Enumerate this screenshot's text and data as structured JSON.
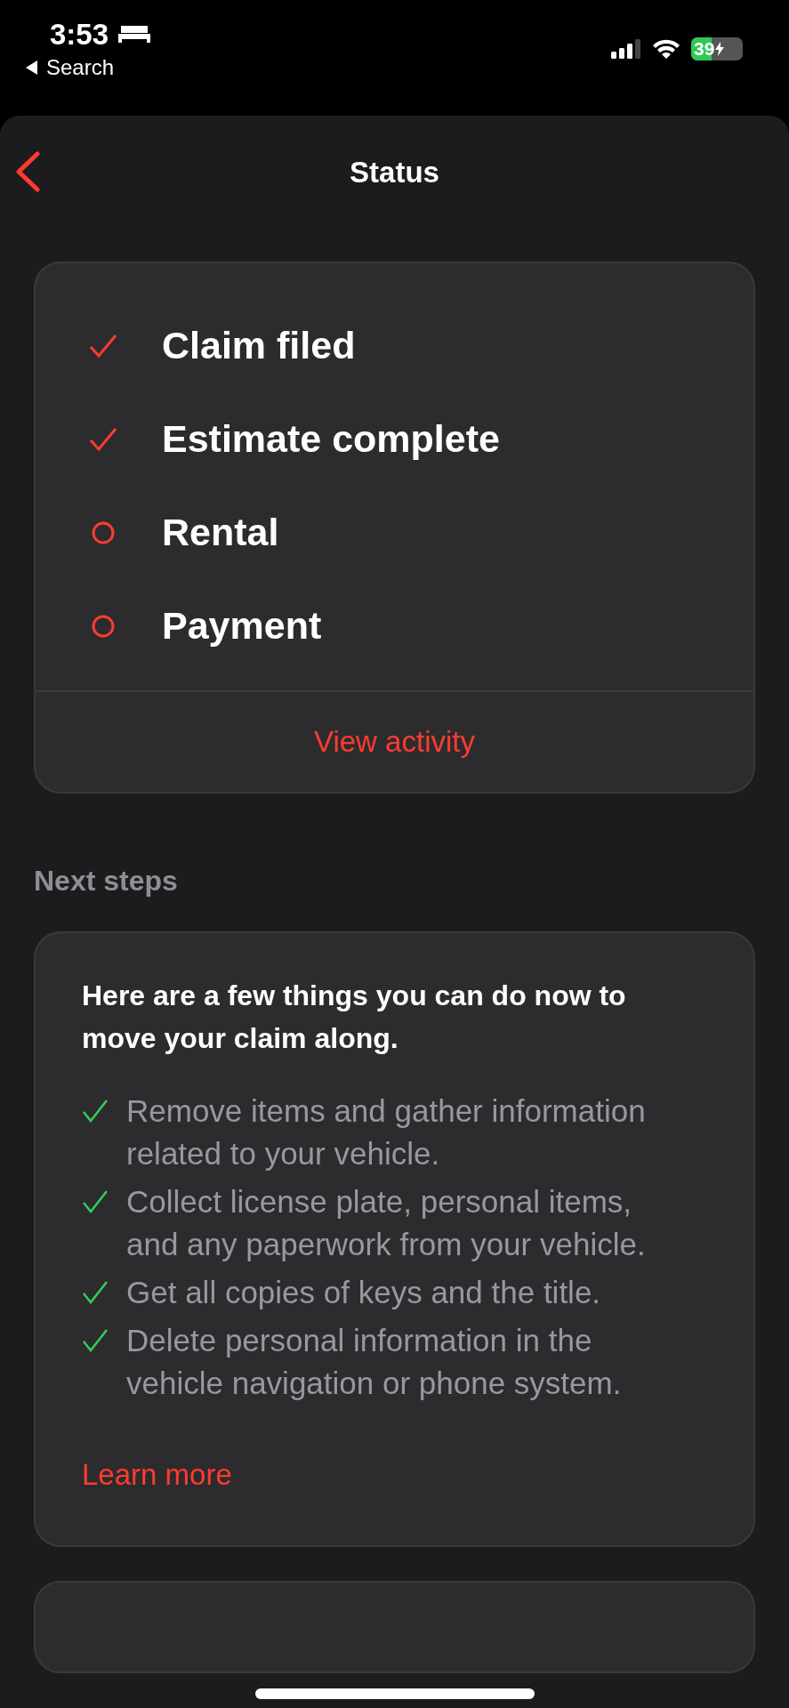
{
  "status_bar": {
    "time": "3:53",
    "back_label": "Search",
    "battery": "39"
  },
  "header": {
    "title": "Status"
  },
  "status_card": {
    "steps": [
      {
        "label": "Claim filed",
        "done": true
      },
      {
        "label": "Estimate complete",
        "done": true
      },
      {
        "label": "Rental",
        "done": false
      },
      {
        "label": "Payment",
        "done": false
      }
    ],
    "link": "View activity"
  },
  "next_steps": {
    "heading": "Next steps",
    "intro": "Here are a few things you can do now to move your claim along.",
    "items": [
      {
        "text": "Remove items and gather information related to your vehicle.",
        "done": true
      },
      {
        "text": "Collect license plate, personal items, and any paperwork from your vehicle.",
        "done": true
      },
      {
        "text": "Get all copies of keys and the title.",
        "done": true
      },
      {
        "text": "Delete personal information in the vehicle navigation or phone system.",
        "done": true
      }
    ],
    "link": "Learn more"
  }
}
